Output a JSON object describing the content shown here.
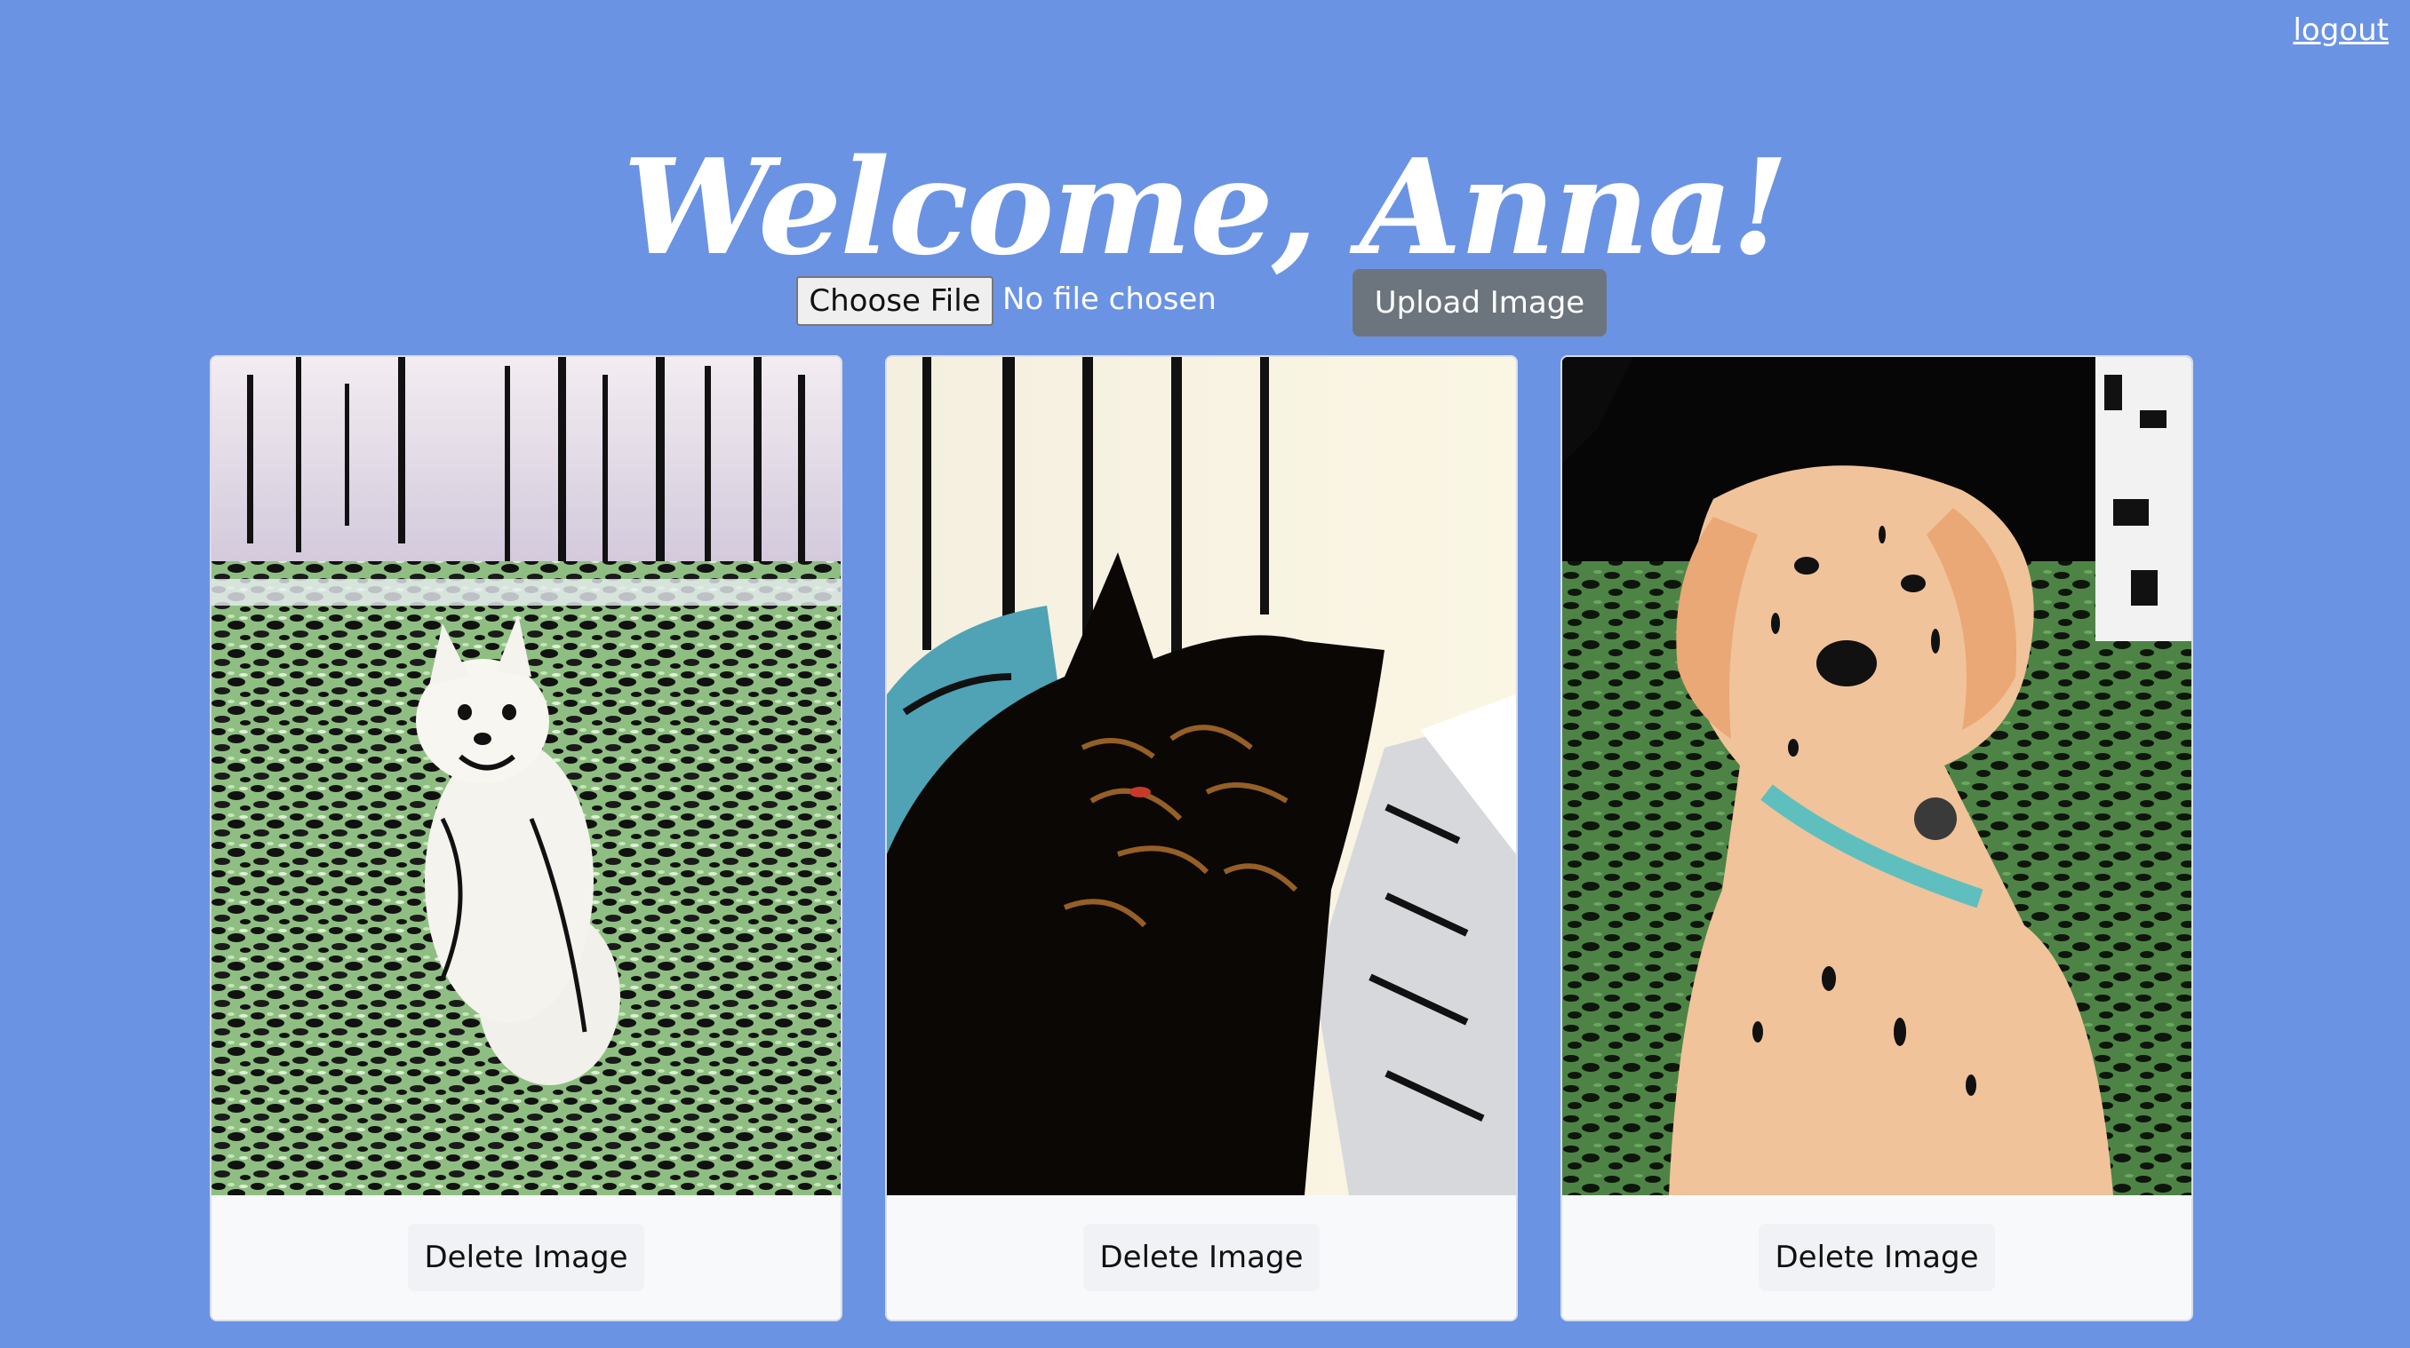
{
  "header": {
    "logout_label": "logout",
    "welcome_title": "Welcome, Anna!"
  },
  "upload": {
    "choose_file_label": "Choose File",
    "file_status": "No file chosen",
    "upload_label": "Upload Image"
  },
  "gallery": {
    "cards": [
      {
        "subject": "dog-white-fence",
        "delete_label": "Delete Image"
      },
      {
        "subject": "cat-dark",
        "delete_label": "Delete Image"
      },
      {
        "subject": "puppy-golden",
        "delete_label": "Delete Image"
      }
    ]
  },
  "colors": {
    "page_background": "#6b93e4",
    "upload_button": "#6c757d",
    "card_footer": "#f8f9fb"
  }
}
